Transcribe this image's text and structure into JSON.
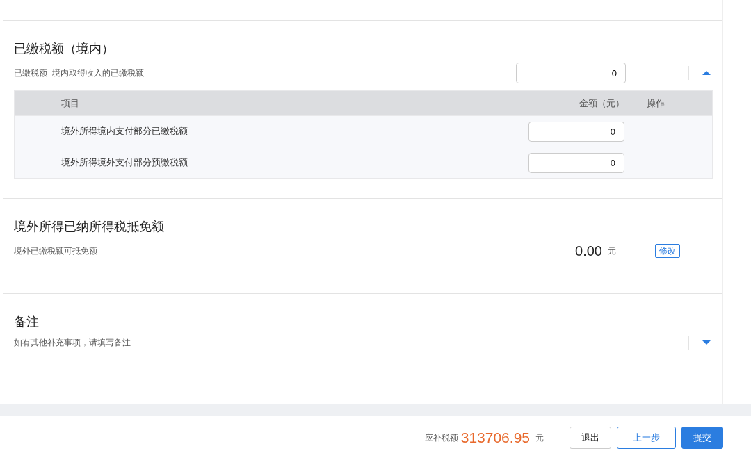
{
  "paid_tax_section": {
    "title": "已缴税额（境内）",
    "subtitle": "已缴税额=境内取得收入的已缴税额",
    "total_value": "0",
    "expanded": true,
    "table": {
      "columns": [
        "项目",
        "金额（元）",
        "操作"
      ],
      "rows": [
        {
          "item": "境外所得境内支付部分已缴税额",
          "amount": "0"
        },
        {
          "item": "境外所得境外支付部分预缴税额",
          "amount": "0"
        }
      ]
    }
  },
  "credit_section": {
    "title": "境外所得已纳所得税抵免额",
    "subtitle": "境外已缴税额可抵免额",
    "value": "0.00",
    "unit": "元",
    "edit_button": "修改"
  },
  "remarks_section": {
    "title": "备注",
    "subtitle": "如有其他补充事项，请填写备注",
    "expanded": false
  },
  "footer": {
    "label": "应补税额",
    "amount": "313706.95",
    "unit": "元",
    "buttons": [
      {
        "label": "退出",
        "kind": "default"
      },
      {
        "label": "上一步",
        "kind": "outline"
      },
      {
        "label": "提交",
        "kind": "primary"
      }
    ]
  }
}
